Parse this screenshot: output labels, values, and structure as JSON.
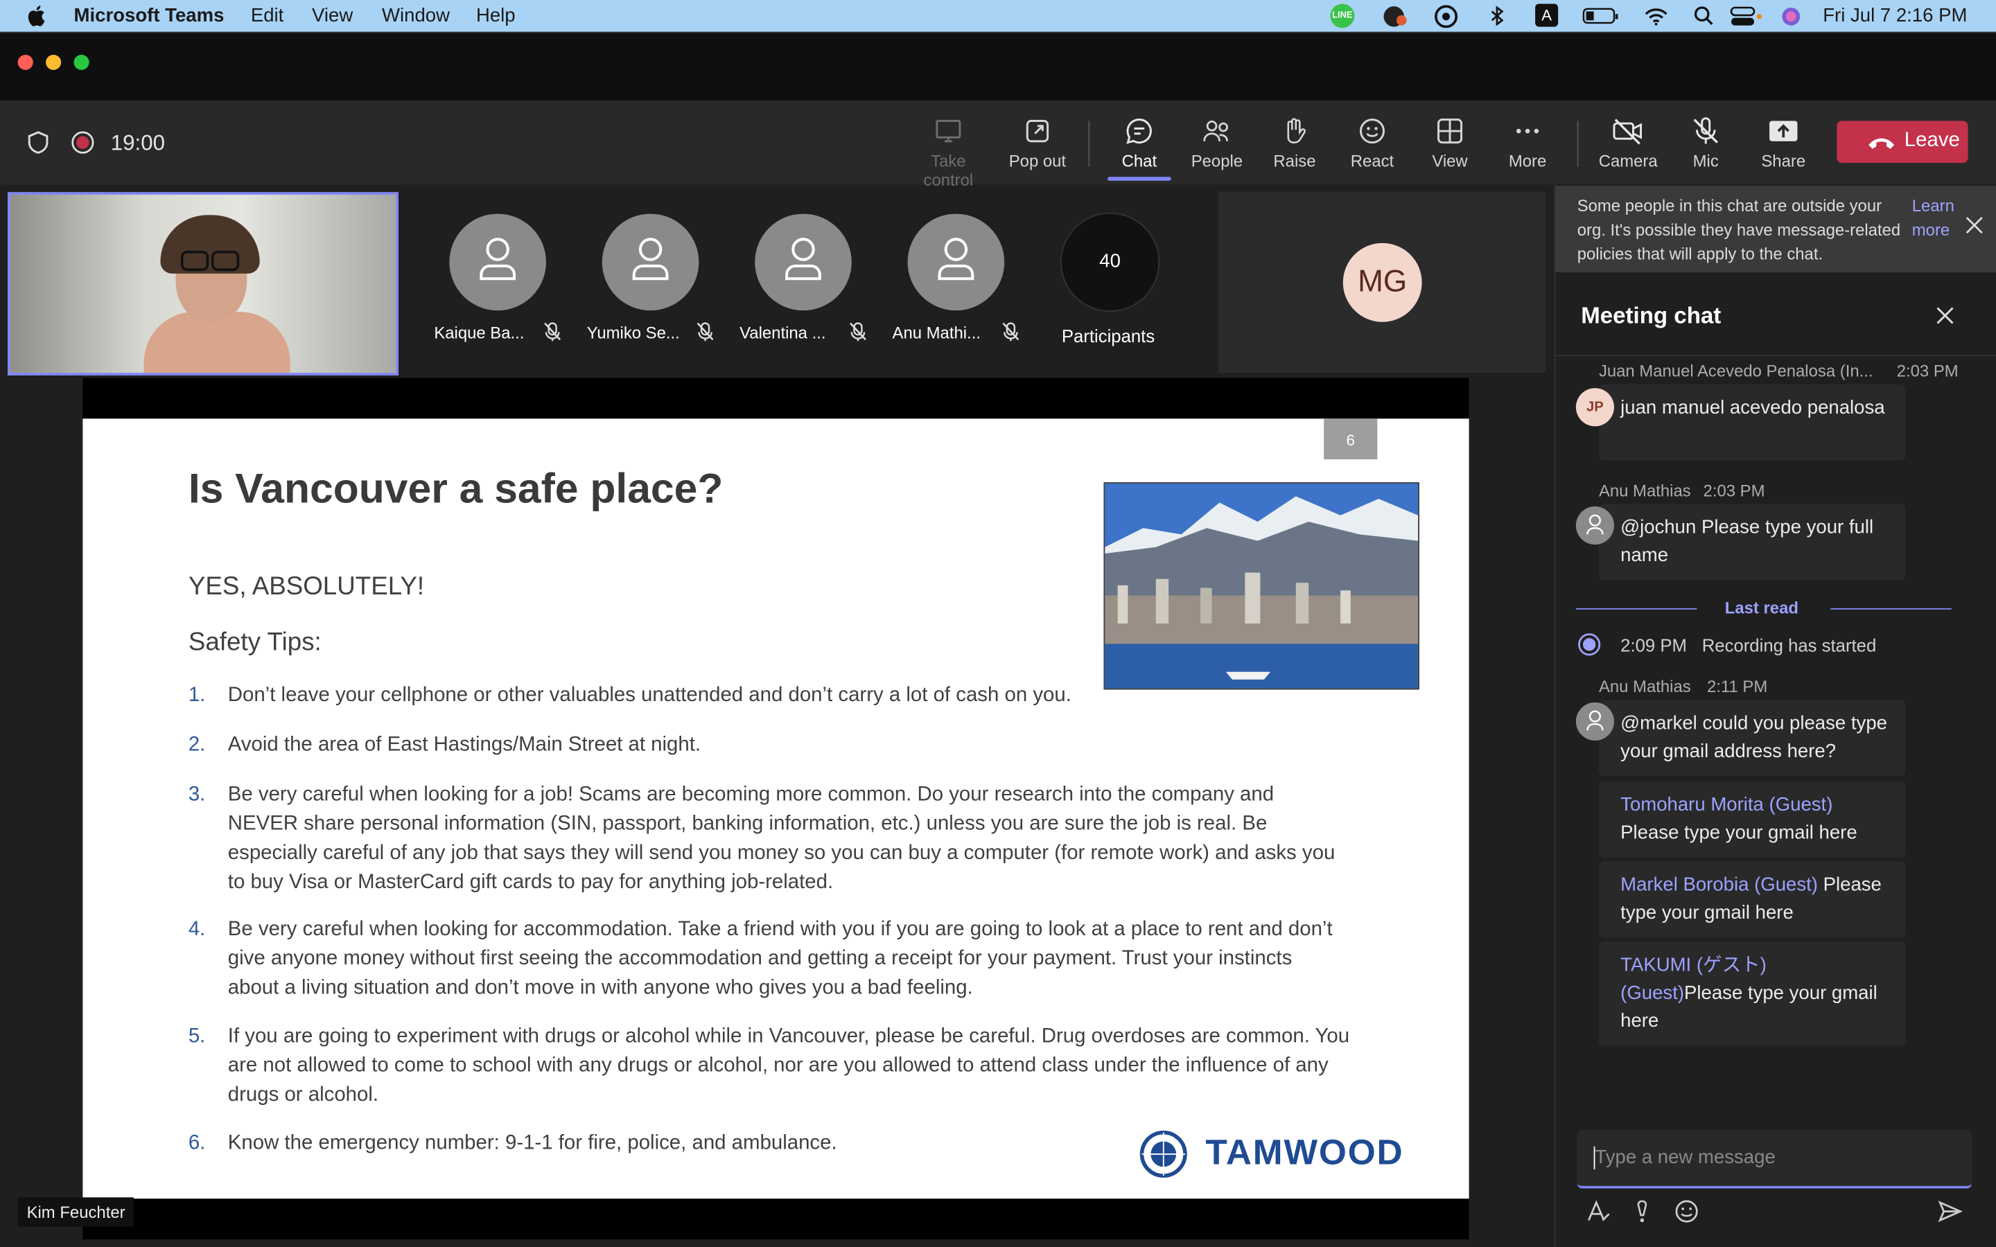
{
  "menubar": {
    "app_name": "Microsoft Teams",
    "menus": [
      "Edit",
      "View",
      "Window",
      "Help"
    ],
    "datetime": "Fri Jul 7  2:16 PM"
  },
  "meeting": {
    "timer": "19:00"
  },
  "toolbar": {
    "take_control": "Take control",
    "pop_out": "Pop out",
    "chat": "Chat",
    "people": "People",
    "raise": "Raise",
    "react": "React",
    "view": "View",
    "more": "More",
    "camera": "Camera",
    "mic": "Mic",
    "share": "Share",
    "leave": "Leave"
  },
  "participants": [
    {
      "name": "Kaique Ba..."
    },
    {
      "name": "Yumiko Se..."
    },
    {
      "name": "Valentina ..."
    },
    {
      "name": "Anu Mathi..."
    }
  ],
  "participants_count": "40",
  "participants_label": "Participants",
  "mg_initials": "MG",
  "presenter_name": "Kim Feuchter",
  "slide": {
    "page_number": "6",
    "title": "Is Vancouver a safe place?",
    "subtitle": "YES, ABSOLUTELY!",
    "section": "Safety Tips:",
    "tips": [
      {
        "num": "1.",
        "text": "Don’t leave your cellphone or other valuables unattended and don’t carry a lot of cash on you."
      },
      {
        "num": "2.",
        "text": "Avoid the area of East Hastings/Main Street at night."
      },
      {
        "num": "3.",
        "text": "Be very careful when looking for a job!  Scams are becoming more common.  Do your research into the company and NEVER share personal information (SIN, passport, banking information, etc.) unless you are sure the job is real.  Be especially careful of any job that says they will send you money so you can buy a computer (for remote work) and asks you to buy Visa or MasterCard gift cards to pay for anything job-related."
      },
      {
        "num": "4.",
        "text": "Be very careful when looking for accommodation.  Take a friend with you if you are going to look at a place to rent and don’t give anyone money without first seeing the accommodation and getting a receipt for your payment.  Trust your instincts about a living situation and don’t move in with anyone who gives you a bad feeling."
      },
      {
        "num": "5.",
        "text": "If you are going to experiment with drugs or alcohol while in Vancouver, please be careful.  Drug overdoses are common.  You are not allowed to come to school with any drugs or alcohol, nor are you allowed to attend class under the influence of any drugs or alcohol."
      },
      {
        "num": "6.",
        "text": "Know the emergency number: 9-1-1 for fire, police, and ambulance."
      }
    ],
    "logo_text": "TAMWOOD"
  },
  "chat": {
    "notice": "Some people in this chat are outside your org. It's possible they have message-related policies that will apply to the chat.",
    "notice_link": "Learn more",
    "title": "Meeting chat",
    "messages": [
      {
        "sender": "Juan Manuel Acevedo Penalosa (In...",
        "time": "2:03 PM",
        "initials": "JP",
        "text": "juan manuel acevedo penalosa"
      },
      {
        "sender": "Anu Mathias",
        "time": "2:03 PM",
        "text": "@jochun Please type your full name"
      }
    ],
    "last_read": "Last read",
    "event": {
      "time": "2:09 PM",
      "text": "Recording has started"
    },
    "group": {
      "sender": "Anu Mathias",
      "time": "2:11 PM",
      "first_text": "@markel could you please type your gmail address here?",
      "mentions": [
        {
          "mention": "Tomoharu Morita (Guest)",
          "text": " Please type your gmail here"
        },
        {
          "mention": "Markel Borobia (Guest)",
          "text": " Please type your gmail here"
        },
        {
          "mention": "TAKUMI (ゲスト) (Guest)",
          "text": "Please type your gmail here"
        }
      ]
    },
    "composer_placeholder": "Type a new message"
  },
  "colors": {
    "accent": "#7f85f5",
    "leave": "#c4314b",
    "menubar": "#a9d3f5",
    "record": "#c4314b",
    "mention": "#9ea2ff"
  }
}
